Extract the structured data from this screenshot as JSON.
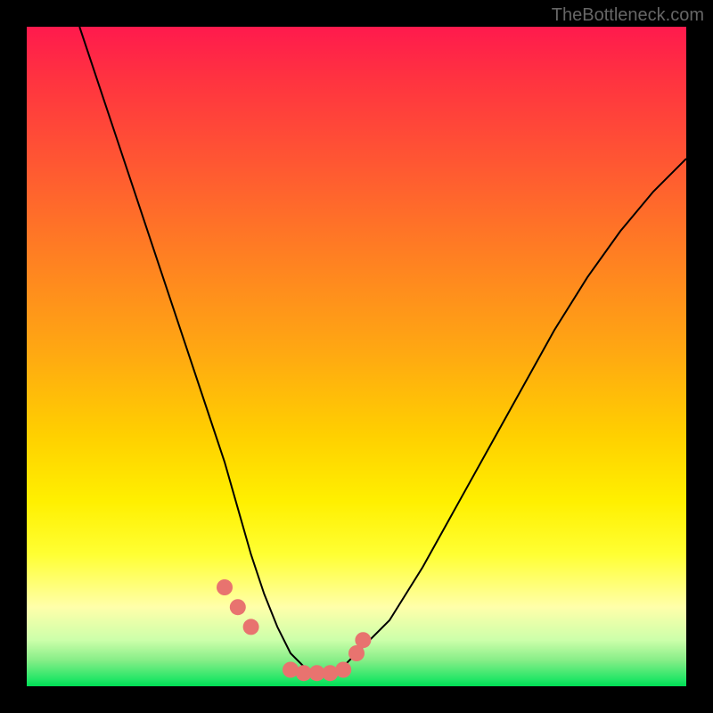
{
  "watermark": "TheBottleneck.com",
  "chart_data": {
    "type": "line",
    "title": "",
    "xlabel": "",
    "ylabel": "",
    "xlim": [
      0,
      100
    ],
    "ylim": [
      0,
      100
    ],
    "series": [
      {
        "name": "bottleneck-curve",
        "x": [
          8,
          12,
          16,
          20,
          24,
          28,
          30,
          32,
          34,
          36,
          38,
          40,
          42,
          44,
          46,
          48,
          50,
          55,
          60,
          65,
          70,
          75,
          80,
          85,
          90,
          95,
          100
        ],
        "y": [
          100,
          88,
          76,
          64,
          52,
          40,
          34,
          27,
          20,
          14,
          9,
          5,
          3,
          2,
          2,
          3,
          5,
          10,
          18,
          27,
          36,
          45,
          54,
          62,
          69,
          75,
          80
        ]
      }
    ],
    "markers": {
      "name": "highlight-points",
      "color": "#e8736f",
      "x": [
        30,
        32,
        34,
        40,
        42,
        44,
        46,
        48,
        50,
        51
      ],
      "y": [
        15,
        12,
        9,
        2.5,
        2,
        2,
        2,
        2.5,
        5,
        7
      ]
    }
  }
}
